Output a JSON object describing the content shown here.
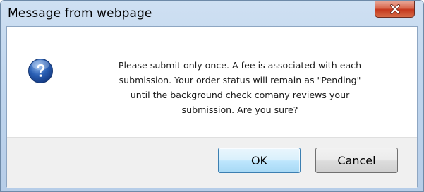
{
  "dialog": {
    "title": "Message from webpage",
    "message_lines": [
      "Please submit only once. A fee is associated with each",
      "submission. Your order status will remain as \"Pending\"",
      "until the background check comany reviews your",
      "submission. Are you sure?"
    ],
    "icon": "question-icon",
    "ok_label": "OK",
    "cancel_label": "Cancel",
    "close_icon": "close-icon"
  },
  "colors": {
    "titlebar": "#c0d6ee",
    "close_button": "#c4381d",
    "question_icon": "#2a5fb4",
    "button_area": "#f0f0f0",
    "default_button_border": "#3c7fb1"
  }
}
